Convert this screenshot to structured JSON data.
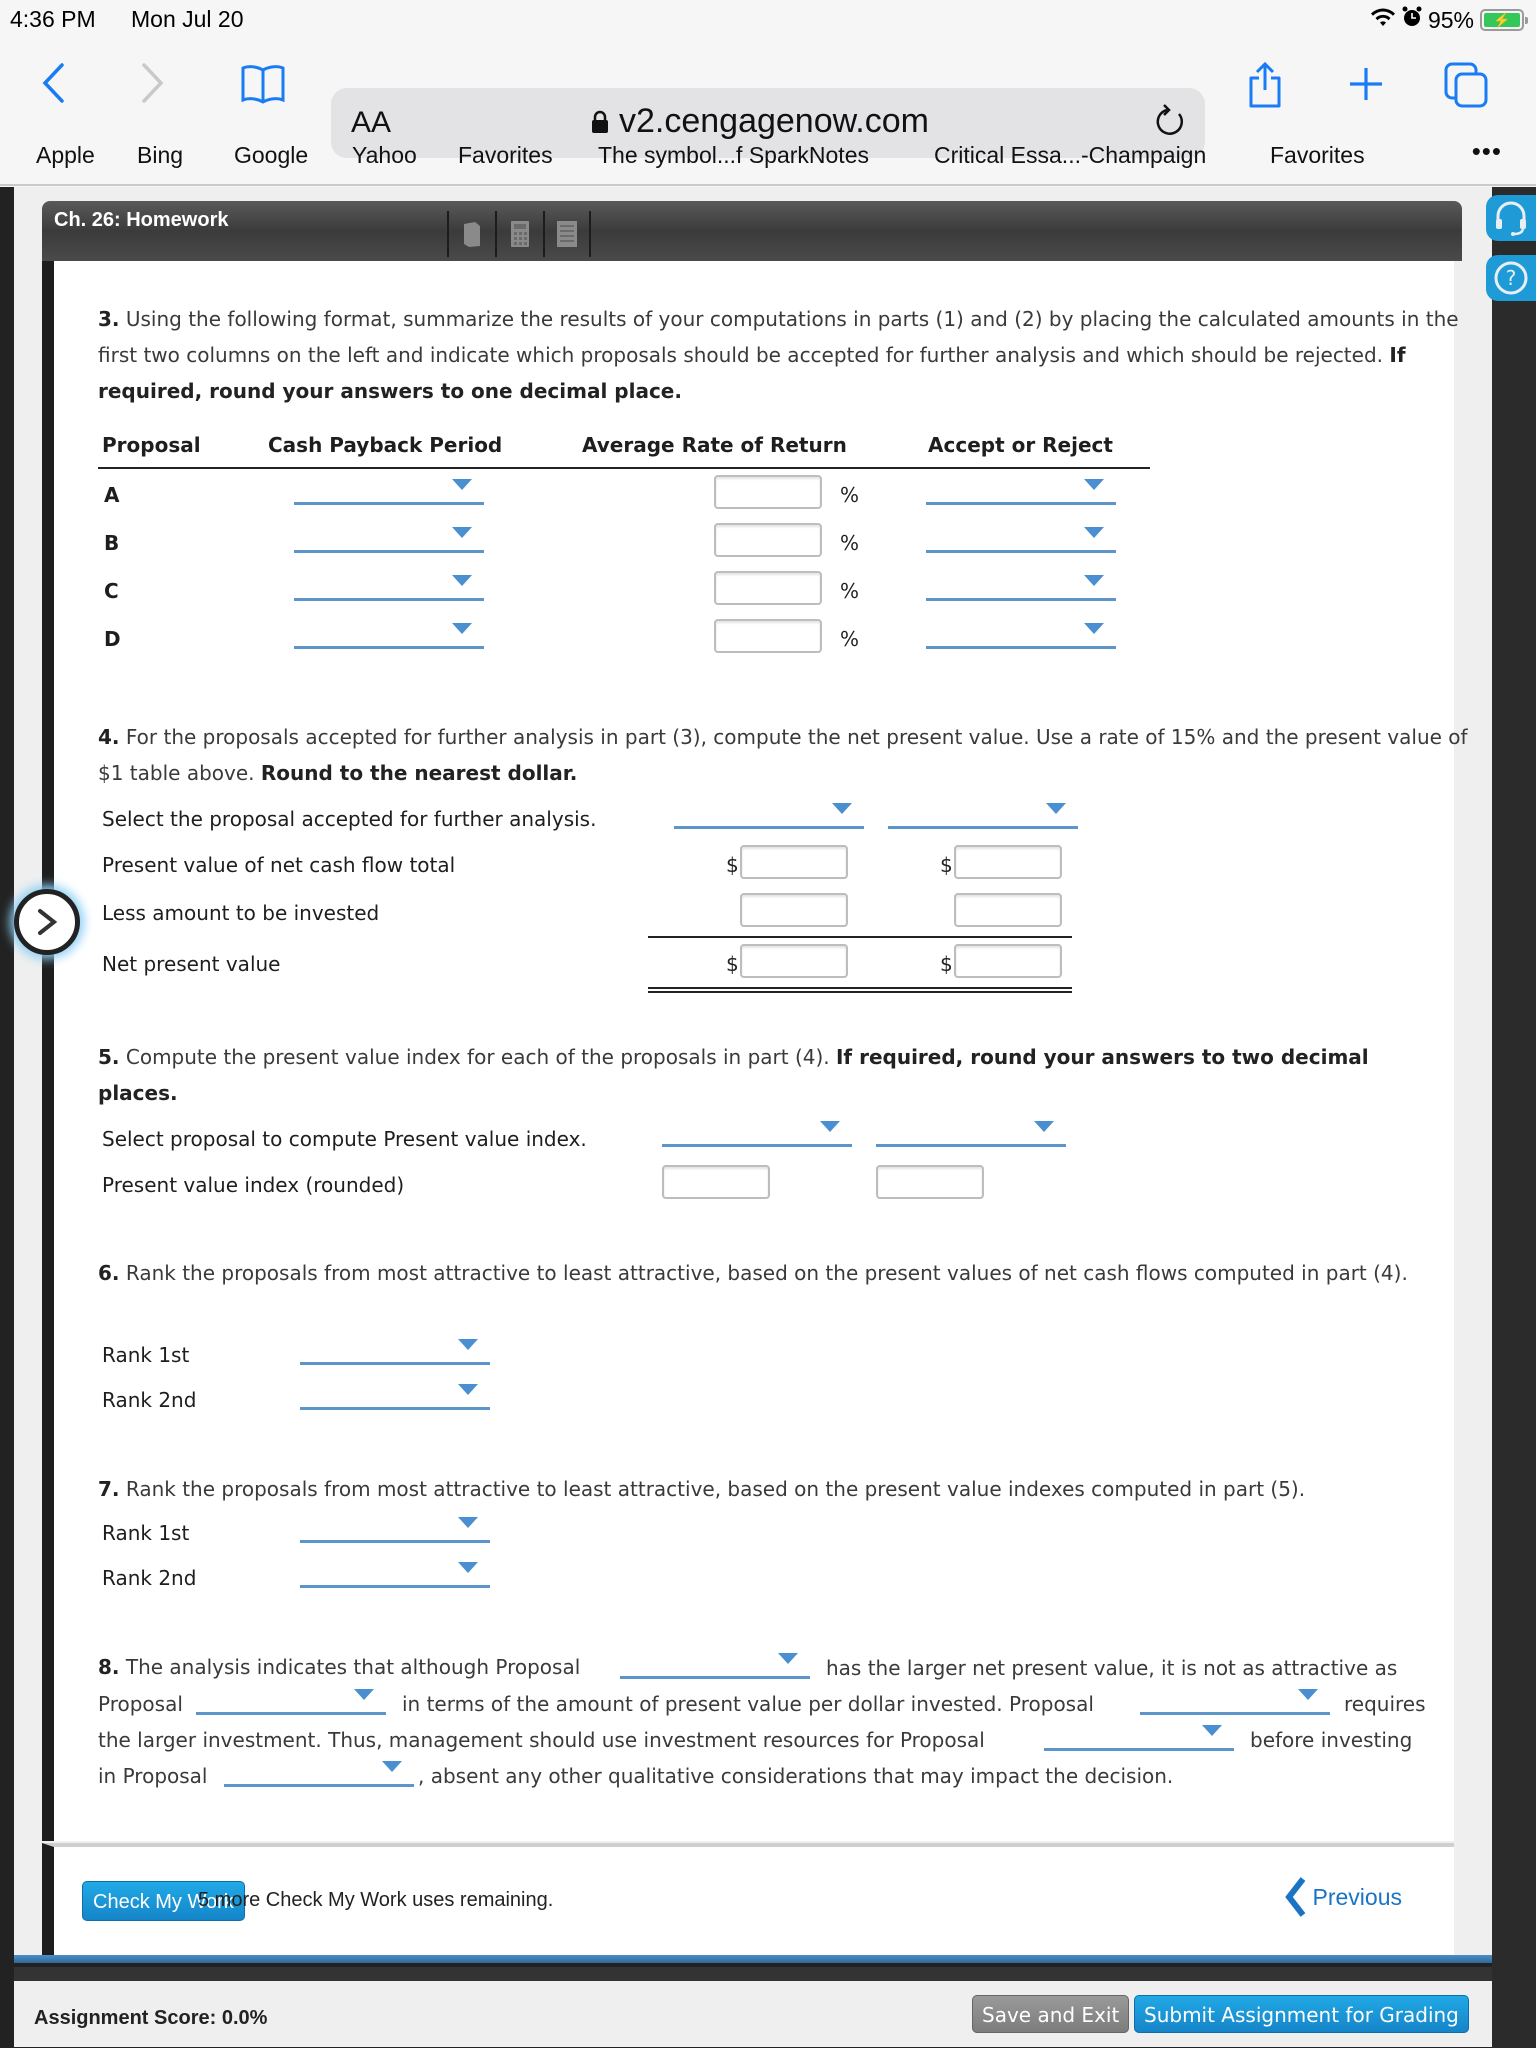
{
  "status_bar": {
    "time": "4:36 PM",
    "date": "Mon Jul 20",
    "battery_percent": "95%"
  },
  "browser": {
    "text_size_label": "AA",
    "url_host": "v2.cengagenow.com",
    "favorites": [
      "Apple",
      "Bing",
      "Google",
      "Yahoo",
      "Favorites",
      "The symbol...f SparkNotes",
      "Critical Essa...-Champaign",
      "Favorites"
    ],
    "more_label": "•••"
  },
  "assignment": {
    "title": "Ch. 26: Homework"
  },
  "q3": {
    "number": "3.",
    "text": "Using the following format, summarize the results of your computations in parts (1) and (2) by placing the calculated amounts in the first two columns on the left and indicate which proposals should be accepted for further analysis and which should be rejected.",
    "instruction": "If required, round your answers to one decimal place.",
    "headers": [
      "Proposal",
      "Cash Payback Period",
      "Average Rate of Return",
      "Accept or Reject"
    ],
    "rows": [
      {
        "proposal": "A",
        "cash_payback": "",
        "avg_rate": "",
        "unit": "%",
        "decision": ""
      },
      {
        "proposal": "B",
        "cash_payback": "",
        "avg_rate": "",
        "unit": "%",
        "decision": ""
      },
      {
        "proposal": "C",
        "cash_payback": "",
        "avg_rate": "",
        "unit": "%",
        "decision": ""
      },
      {
        "proposal": "D",
        "cash_payback": "",
        "avg_rate": "",
        "unit": "%",
        "decision": ""
      }
    ]
  },
  "q4": {
    "number": "4.",
    "text": "For the proposals accepted for further analysis in part (3), compute the net present value. Use a rate of 15% and the present value of $1 table above.",
    "instruction": "Round to the nearest dollar.",
    "rows": [
      {
        "label": "Select the proposal accepted for further analysis."
      },
      {
        "label": "Present value of net cash flow total",
        "prefix": "$"
      },
      {
        "label": "Less amount to be invested",
        "prefix": ""
      },
      {
        "label": "Net present value",
        "prefix": "$"
      }
    ]
  },
  "q5": {
    "number": "5.",
    "text": "Compute the present value index for each of the proposals in part (4).",
    "instruction": "If required, round your answers to two decimal places.",
    "rows": [
      {
        "label": "Select proposal to compute Present value index."
      },
      {
        "label": "Present value index (rounded)"
      }
    ]
  },
  "q6": {
    "number": "6.",
    "text": "Rank the proposals from most attractive to least attractive, based on the present values of net cash flows computed in part (4).",
    "ranks": [
      "Rank 1st",
      "Rank 2nd"
    ]
  },
  "q7": {
    "number": "7.",
    "text": "Rank the proposals from most attractive to least attractive, based on the present value indexes computed in part (5).",
    "ranks": [
      "Rank 1st",
      "Rank 2nd"
    ]
  },
  "q8": {
    "number": "8.",
    "segments": [
      "The analysis indicates that although Proposal",
      "has the larger net present value, it is not as attractive as",
      "Proposal",
      "in terms of the amount of present value per dollar invested. Proposal",
      "requires",
      "the larger investment. Thus, management should use investment resources for Proposal",
      "before investing",
      "in Proposal",
      ", absent any other qualitative considerations that may impact the decision."
    ]
  },
  "footer": {
    "check_button": "Check My Work",
    "check_note": "5 more Check My Work uses remaining.",
    "previous": "Previous",
    "score": "Assignment Score: 0.0%",
    "save_exit": "Save and Exit",
    "submit": "Submit Assignment for Grading"
  },
  "colors": {
    "accent_blue": "#1a7cf5",
    "button_blue": "#1c98d8",
    "dropdown_blue": "#5b95c9"
  }
}
